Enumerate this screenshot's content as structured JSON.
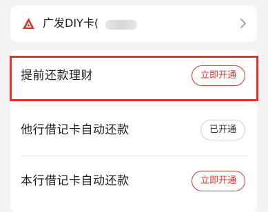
{
  "card": {
    "name": "广发DIY卡(",
    "logo_icon": "cgb-bank-logo",
    "chevron_icon": "chevron-right-icon"
  },
  "rows": [
    {
      "label": "提前还款理财",
      "button": "立即开通",
      "status": "not-opened"
    },
    {
      "label": "他行借记卡自动还款",
      "button": "已开通",
      "status": "opened"
    },
    {
      "label": "本行借记卡自动还款",
      "button": "立即开通",
      "status": "not-opened"
    }
  ],
  "colors": {
    "accent": "#d9342b",
    "highlight": "#e5332a"
  }
}
